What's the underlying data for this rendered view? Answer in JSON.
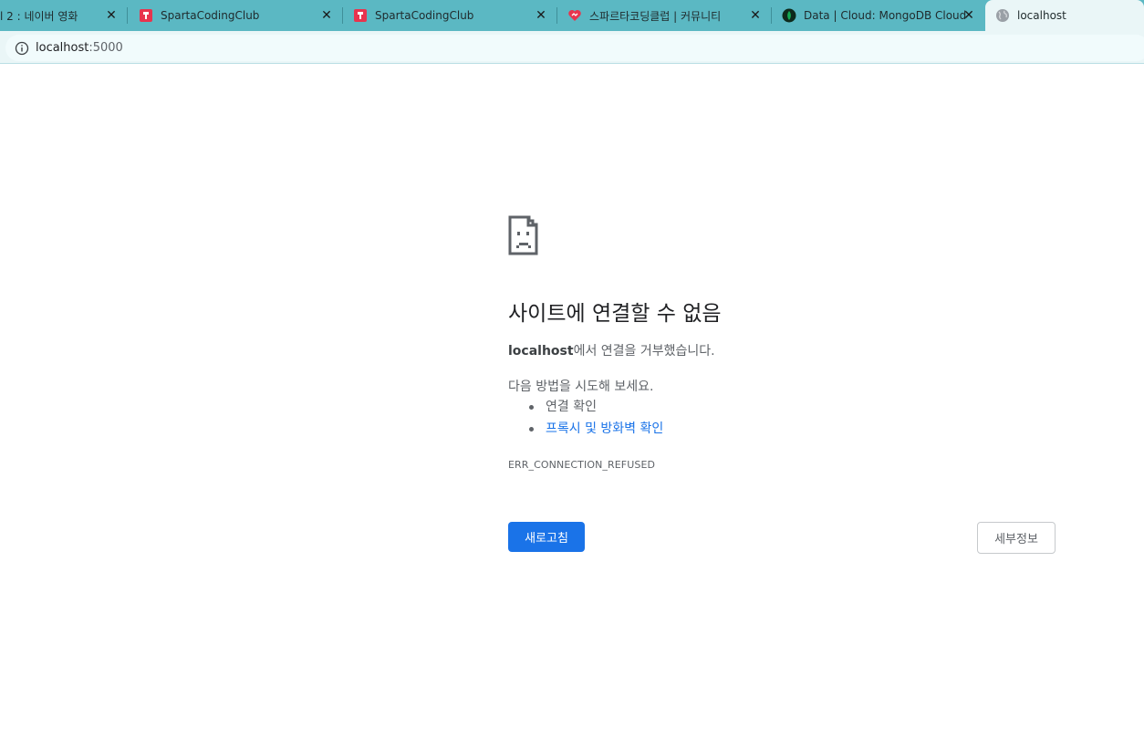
{
  "tabs": [
    {
      "title": "l 2 : 네이버 영화",
      "favicon": "none",
      "close_label": "✕"
    },
    {
      "title": "SpartaCodingClub",
      "favicon": "sparta-icon",
      "close_label": "✕"
    },
    {
      "title": "SpartaCodingClub",
      "favicon": "sparta-icon",
      "close_label": "✕"
    },
    {
      "title": "스파르타코딩클럽 | 커뮤니티",
      "favicon": "heart-icon",
      "close_label": "✕"
    },
    {
      "title": "Data | Cloud: MongoDB Cloud",
      "favicon": "mongodb-leaf-icon",
      "close_label": "✕"
    },
    {
      "title": "localhost",
      "favicon": "globe-icon",
      "active": true
    }
  ],
  "address_bar": {
    "host": "localhost",
    "port": ":5000",
    "icon": "info-icon"
  },
  "error_page": {
    "icon": "sad-document-icon",
    "heading": "사이트에 연결할 수 없음",
    "host_bold": "localhost",
    "description_rest": "에서 연결을 거부했습니다.",
    "try_label": "다음 방법을 시도해 보세요.",
    "suggestions": [
      {
        "text": "연결 확인",
        "is_link": false
      },
      {
        "text": "프록시 및 방화벽 확인",
        "is_link": true
      }
    ],
    "error_code": "ERR_CONNECTION_REFUSED",
    "reload_button": "새로고침",
    "details_button": "세부정보"
  },
  "colors": {
    "tabstrip": "#5bb8c3",
    "active_tab": "#eaf6f7",
    "primary_button": "#1a73e8",
    "link": "#1a73e8"
  }
}
